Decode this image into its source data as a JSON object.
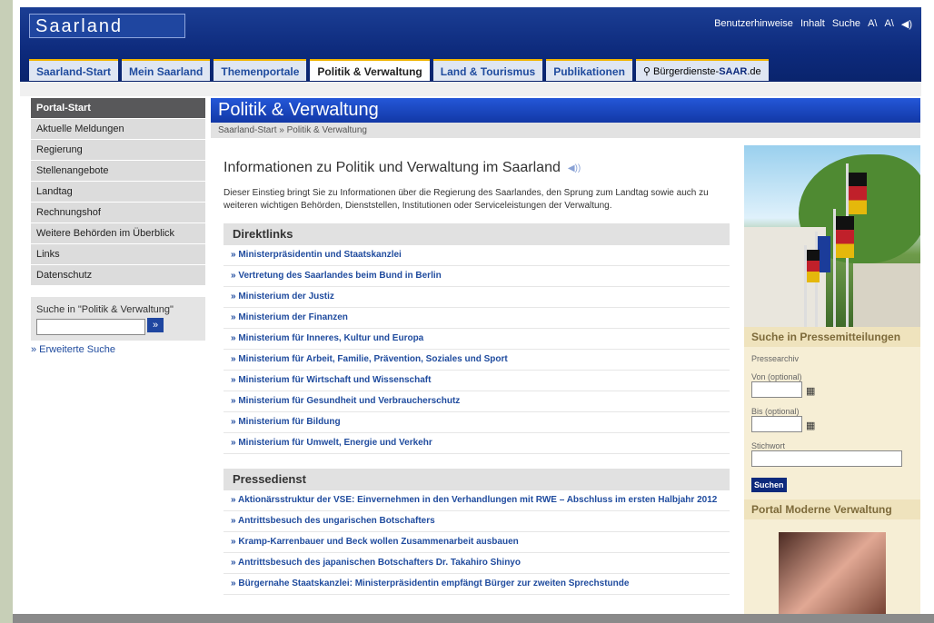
{
  "header": {
    "logo": "Saarland",
    "util_links": [
      "Benutzerhinweise",
      "Inhalt",
      "Suche",
      "A\\",
      "A\\",
      "◀)"
    ],
    "tabs": [
      {
        "label": "Saarland-Start"
      },
      {
        "label": "Mein Saarland"
      },
      {
        "label": "Themenportale"
      },
      {
        "label": "Politik & Verwaltung",
        "active": true
      },
      {
        "label": "Land & Tourismus"
      },
      {
        "label": "Publikationen"
      }
    ],
    "service_tab": {
      "prefix": "Bürgerdienste-",
      "brand": "SAAR",
      "suffix": ".de"
    }
  },
  "sidebar": {
    "items": [
      "Portal-Start",
      "Aktuelle Meldungen",
      "Regierung",
      "Stellenangebote",
      "Landtag",
      "Rechnungshof",
      "Weitere Behörden im Überblick",
      "Links",
      "Datenschutz"
    ],
    "search_label": "Suche in \"Politik & Verwaltung\"",
    "search_button": "»",
    "advanced": "» Erweiterte Suche"
  },
  "main": {
    "title": "Politik & Verwaltung",
    "breadcrumb": "Saarland-Start » Politik & Verwaltung",
    "heading": "Informationen zu Politik und Verwaltung im Saarland",
    "intro": "Dieser Einstieg bringt Sie zu Informationen über die Regierung des Saarlandes, den Sprung zum Landtag sowie auch zu weiteren wichtigen Behörden, Dienststellen, Institutionen oder Serviceleistungen der Verwaltung.",
    "direktlinks_title": "Direktlinks",
    "direktlinks": [
      "Ministerpräsidentin und Staatskanzlei",
      "Vertretung des Saarlandes beim Bund in Berlin",
      "Ministerium der Justiz",
      "Ministerium der Finanzen",
      "Ministerium für Inneres, Kultur und Europa",
      "Ministerium für Arbeit, Familie, Prävention, Soziales und Sport",
      "Ministerium für Wirtschaft und Wissenschaft",
      "Ministerium für Gesundheit und Verbraucherschutz",
      "Ministerium für Bildung",
      "Ministerium für Umwelt, Energie und Verkehr"
    ],
    "pressedienst_title": "Pressedienst",
    "pressedienst": [
      "Aktionärsstruktur der VSE: Einvernehmen in den Verhandlungen mit RWE – Abschluss im ersten Halbjahr 2012",
      "Antrittsbesuch des ungarischen Botschafters",
      "Kramp-Karrenbauer und Beck wollen Zusammenarbeit ausbauen",
      "Antrittsbesuch des japanischen Botschafters Dr. Takahiro Shinyo",
      "Bürgernahe Staatskanzlei: Ministerpräsidentin empfängt Bürger zur zweiten Sprechstunde"
    ]
  },
  "right": {
    "press_search_title": "Suche in Pressemitteilungen",
    "archive": "Pressearchiv",
    "from_label": "Von (optional)",
    "to_label": "Bis (optional)",
    "keyword_label": "Stichwort",
    "submit": "Suchen",
    "portal_title": "Portal Moderne Verwaltung"
  }
}
